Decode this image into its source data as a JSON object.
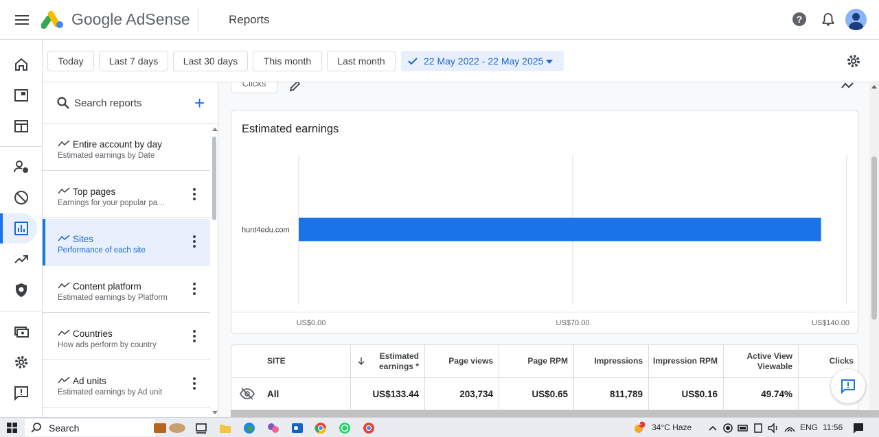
{
  "header": {
    "brand": "Google AdSense",
    "page_title": "Reports"
  },
  "filters": {
    "chips": [
      "Today",
      "Last 7 days",
      "Last 30 days",
      "This month",
      "Last month"
    ],
    "date_range": "22 May 2022 - 22 May 2025"
  },
  "report_list": {
    "search_placeholder": "Search reports",
    "items": [
      {
        "title": "Entire account by day",
        "subtitle": "Estimated earnings by Date"
      },
      {
        "title": "Top pages",
        "subtitle": "Earnings for your popular pages"
      },
      {
        "title": "Sites",
        "subtitle": "Performance of each site"
      },
      {
        "title": "Content platform",
        "subtitle": "Estimated earnings by Platform"
      },
      {
        "title": "Countries",
        "subtitle": "How ads perform by country"
      },
      {
        "title": "Ad units",
        "subtitle": "Estimated earnings by Ad unit"
      }
    ]
  },
  "main": {
    "metric_chip": "Clicks",
    "chart_title": "Estimated earnings"
  },
  "chart_data": {
    "type": "bar",
    "orientation": "horizontal",
    "title": "Estimated earnings",
    "categories": [
      "hunt4edu.com"
    ],
    "values": [
      133.44
    ],
    "xlim": [
      0,
      140
    ],
    "x_ticks": [
      "US$0.00",
      "US$70.00",
      "US$140.00"
    ],
    "bar_color": "#1a73e8",
    "grid": true
  },
  "table": {
    "headers": [
      "SITE",
      "Estimated earnings *",
      "Page views",
      "Page RPM",
      "Impressions",
      "Impression RPM",
      "Active View Viewable",
      "Clicks"
    ],
    "rows": [
      {
        "site": "All",
        "earnings": "US$133.44",
        "page_views": "203,734",
        "page_rpm": "US$0.65",
        "impressions": "811,789",
        "impression_rpm": "US$0.16",
        "active_view": "49.74%"
      }
    ]
  },
  "taskbar": {
    "search": "Search",
    "weather": "34°C  Haze",
    "lang": "ENG",
    "time": "11:56",
    "notif_count": "1"
  },
  "colors": {
    "accent": "#1a73e8",
    "active_bg": "#e8f0fe"
  }
}
